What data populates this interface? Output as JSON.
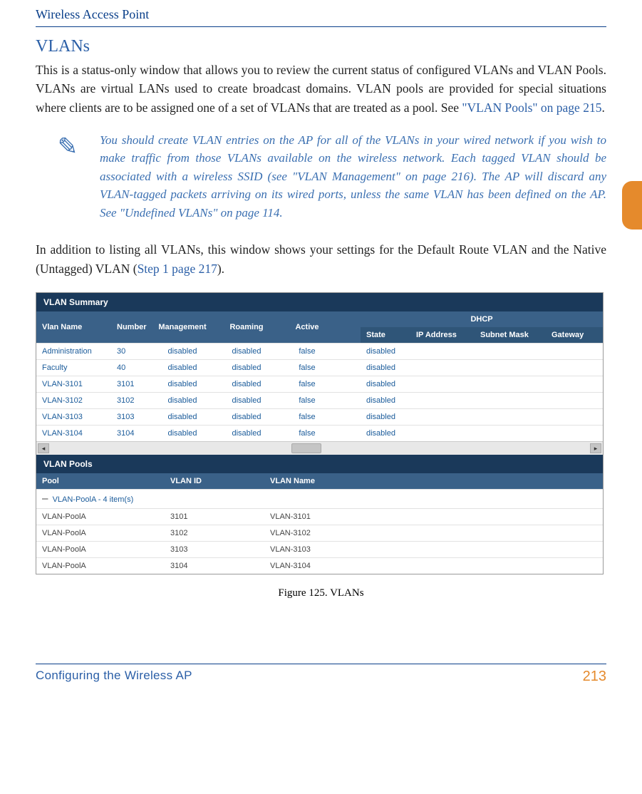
{
  "header": {
    "title": "Wireless Access Point"
  },
  "section": {
    "heading": "VLANs"
  },
  "paragraphs": {
    "intro_pre": "This is a status-only window that allows you to review the current status of configured VLANs and VLAN Pools. VLANs are virtual LANs used to create broadcast domains. VLAN pools are provided for special situations where clients are to be assigned one of a set of VLANs that are treated as a pool. See ",
    "intro_link": "\"VLAN Pools\" on page 215",
    "intro_post": ".",
    "middle_pre": "In addition to listing all VLANs, this window shows your settings for the Default Route VLAN and the Native (Untagged) VLAN (",
    "middle_link": "Step 1 page 217",
    "middle_post": ")."
  },
  "note": {
    "text": "You should create VLAN entries on the AP for all of the VLANs in your wired network if you wish to make traffic from those VLANs available on the wireless network. Each tagged VLAN should be associated with a wireless SSID (see \"VLAN Management\" on page 216). The AP will discard any VLAN-tagged packets arriving on its wired ports, unless the same VLAN has been defined on the AP. See \"Undefined VLANs\" on page 114."
  },
  "vlan_summary": {
    "title": "VLAN Summary",
    "headers": {
      "name": "Vlan Name",
      "number": "Number",
      "management": "Management",
      "roaming": "Roaming",
      "active": "Active",
      "dhcp": "DHCP",
      "state": "State",
      "ip": "IP Address",
      "subnet": "Subnet Mask",
      "gateway": "Gateway"
    },
    "rows": [
      {
        "name": "Administration",
        "number": "30",
        "management": "disabled",
        "roaming": "disabled",
        "active": "false",
        "state": "disabled",
        "ip": "",
        "subnet": "",
        "gateway": ""
      },
      {
        "name": "Faculty",
        "number": "40",
        "management": "disabled",
        "roaming": "disabled",
        "active": "false",
        "state": "disabled",
        "ip": "",
        "subnet": "",
        "gateway": ""
      },
      {
        "name": "VLAN-3101",
        "number": "3101",
        "management": "disabled",
        "roaming": "disabled",
        "active": "false",
        "state": "disabled",
        "ip": "",
        "subnet": "",
        "gateway": ""
      },
      {
        "name": "VLAN-3102",
        "number": "3102",
        "management": "disabled",
        "roaming": "disabled",
        "active": "false",
        "state": "disabled",
        "ip": "",
        "subnet": "",
        "gateway": ""
      },
      {
        "name": "VLAN-3103",
        "number": "3103",
        "management": "disabled",
        "roaming": "disabled",
        "active": "false",
        "state": "disabled",
        "ip": "",
        "subnet": "",
        "gateway": ""
      },
      {
        "name": "VLAN-3104",
        "number": "3104",
        "management": "disabled",
        "roaming": "disabled",
        "active": "false",
        "state": "disabled",
        "ip": "",
        "subnet": "",
        "gateway": ""
      }
    ]
  },
  "vlan_pools": {
    "title": "VLAN Pools",
    "headers": {
      "pool": "Pool",
      "id": "VLAN ID",
      "name": "VLAN Name"
    },
    "group_label": "VLAN-PoolA - 4 item(s)",
    "rows": [
      {
        "pool": "VLAN-PoolA",
        "id": "3101",
        "name": "VLAN-3101"
      },
      {
        "pool": "VLAN-PoolA",
        "id": "3102",
        "name": "VLAN-3102"
      },
      {
        "pool": "VLAN-PoolA",
        "id": "3103",
        "name": "VLAN-3103"
      },
      {
        "pool": "VLAN-PoolA",
        "id": "3104",
        "name": "VLAN-3104"
      }
    ]
  },
  "figure": {
    "caption": "Figure 125. VLANs"
  },
  "footer": {
    "left": "Configuring the Wireless AP",
    "page": "213"
  }
}
